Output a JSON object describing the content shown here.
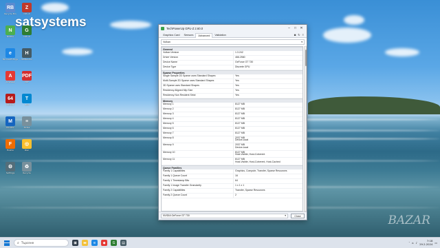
{
  "desktop": {
    "brand_text": "satsystems",
    "watermark_text": "BAZAR",
    "icons": [
      {
        "label": "Recycle Bin",
        "glyph": "RB",
        "color": "#5b8bd0"
      },
      {
        "label": "CPU-Z",
        "glyph": "Z",
        "color": "#c0392b"
      },
      {
        "label": "NVIDIA",
        "glyph": "N",
        "color": "#4caf50"
      },
      {
        "label": "GPU-Z",
        "glyph": "G",
        "color": "#2e7d32"
      },
      {
        "label": "Microsoft Edge",
        "glyph": "e",
        "color": "#1e88e5"
      },
      {
        "label": "HWMonitor",
        "glyph": "H",
        "color": "#455a64"
      },
      {
        "label": "AnyDesk",
        "glyph": "A",
        "color": "#e53935"
      },
      {
        "label": "PDF",
        "glyph": "PDF",
        "color": "#d32f2f"
      },
      {
        "label": "AIDA64",
        "glyph": "64",
        "color": "#b71c1c"
      },
      {
        "label": "Tool",
        "glyph": "T",
        "color": "#0288d1"
      },
      {
        "label": "Monitor",
        "glyph": "M",
        "color": "#1565c0"
      },
      {
        "label": "Notes",
        "glyph": "≡",
        "color": "#78909c"
      },
      {
        "label": "Firefox",
        "glyph": "F",
        "color": "#ef6c00"
      },
      {
        "label": "Disc",
        "glyph": "◎",
        "color": "#fbc02d"
      },
      {
        "label": "Settings",
        "glyph": "⚙",
        "color": "#546e7a"
      },
      {
        "label": "Recycle",
        "glyph": "♻",
        "color": "#78909c"
      }
    ]
  },
  "window": {
    "title": "TechPowerUp GPU-Z 2.60.0",
    "tabs": [
      "Graphics Card",
      "Sensors",
      "Advanced",
      "Validation"
    ],
    "active_tab": "Advanced",
    "selector_value": "Vulkan",
    "sections": [
      {
        "title": "General",
        "rows": [
          {
            "k": "Vulkan Version",
            "v": [
              "1.3.242"
            ]
          },
          {
            "k": "Driver Version",
            "v": [
              "466.2560"
            ]
          },
          {
            "k": "Device Name",
            "v": [
              "GeForce GT 730"
            ]
          },
          {
            "k": "Device Type",
            "v": [
              "Discrete GPU"
            ]
          }
        ]
      },
      {
        "title": "Sparse Properties",
        "rows": [
          {
            "k": "Single Sample 2D Sparse uses Standard Shapes",
            "v": [
              "Yes"
            ]
          },
          {
            "k": "Multi-Sample 2D Sparse uses Standard Shapes",
            "v": [
              "Yes"
            ]
          },
          {
            "k": "3D Sparse uses Standard Shapes",
            "v": [
              "Yes"
            ]
          },
          {
            "k": "Residency Aligned Mip Size",
            "v": [
              "Yes"
            ]
          },
          {
            "k": "Residency Non Resident Strict",
            "v": [
              "Yes"
            ]
          }
        ]
      },
      {
        "title": "Memory",
        "rows": [
          {
            "k": "Memory 1",
            "v": [
              "8127 MB"
            ]
          },
          {
            "k": "Memory 2",
            "v": [
              "8127 MB"
            ]
          },
          {
            "k": "Memory 3",
            "v": [
              "8127 MB"
            ]
          },
          {
            "k": "Memory 4",
            "v": [
              "8127 MB"
            ]
          },
          {
            "k": "Memory 5",
            "v": [
              "8127 MB"
            ]
          },
          {
            "k": "Memory 6",
            "v": [
              "8127 MB"
            ]
          },
          {
            "k": "Memory 7",
            "v": [
              "8127 MB"
            ]
          },
          {
            "k": "Memory 8",
            "v": [
              "2037 MB",
              "Device-local"
            ]
          },
          {
            "k": "Memory 9",
            "v": [
              "2037 MB",
              "Device-local"
            ]
          },
          {
            "k": "Memory 10",
            "v": [
              "8127 MB",
              "Host-Visible, Host-Coherent"
            ]
          },
          {
            "k": "Memory 11",
            "v": [
              "8127 MB",
              "Host-Visible, Host-Coherent, Host-Cached"
            ]
          }
        ]
      },
      {
        "title": "Queue Families",
        "rows": [
          {
            "k": "Family 1 Capabilities",
            "v": [
              "Graphics, Compute, Transfer, Sparse Resources"
            ]
          },
          {
            "k": "Family 1 Queue Count",
            "v": [
              "16"
            ]
          },
          {
            "k": "Family 1 Timestamp Bits",
            "v": [
              "64"
            ]
          },
          {
            "k": "Family 1 Image Transfer Granularity",
            "v": [
              "1 x 1 x 1"
            ]
          },
          {
            "k": "Family 2 Capabilities",
            "v": [
              "Transfer, Sparse Resources"
            ]
          },
          {
            "k": "Family 2 Queue Count",
            "v": [
              "2"
            ]
          }
        ]
      }
    ],
    "gpu_select": "NVIDIA GeForce GT 730",
    "close_label": "Close"
  },
  "taskbar": {
    "search_placeholder": "Търсене",
    "time": "7:18",
    "date": "29.2.2024"
  }
}
